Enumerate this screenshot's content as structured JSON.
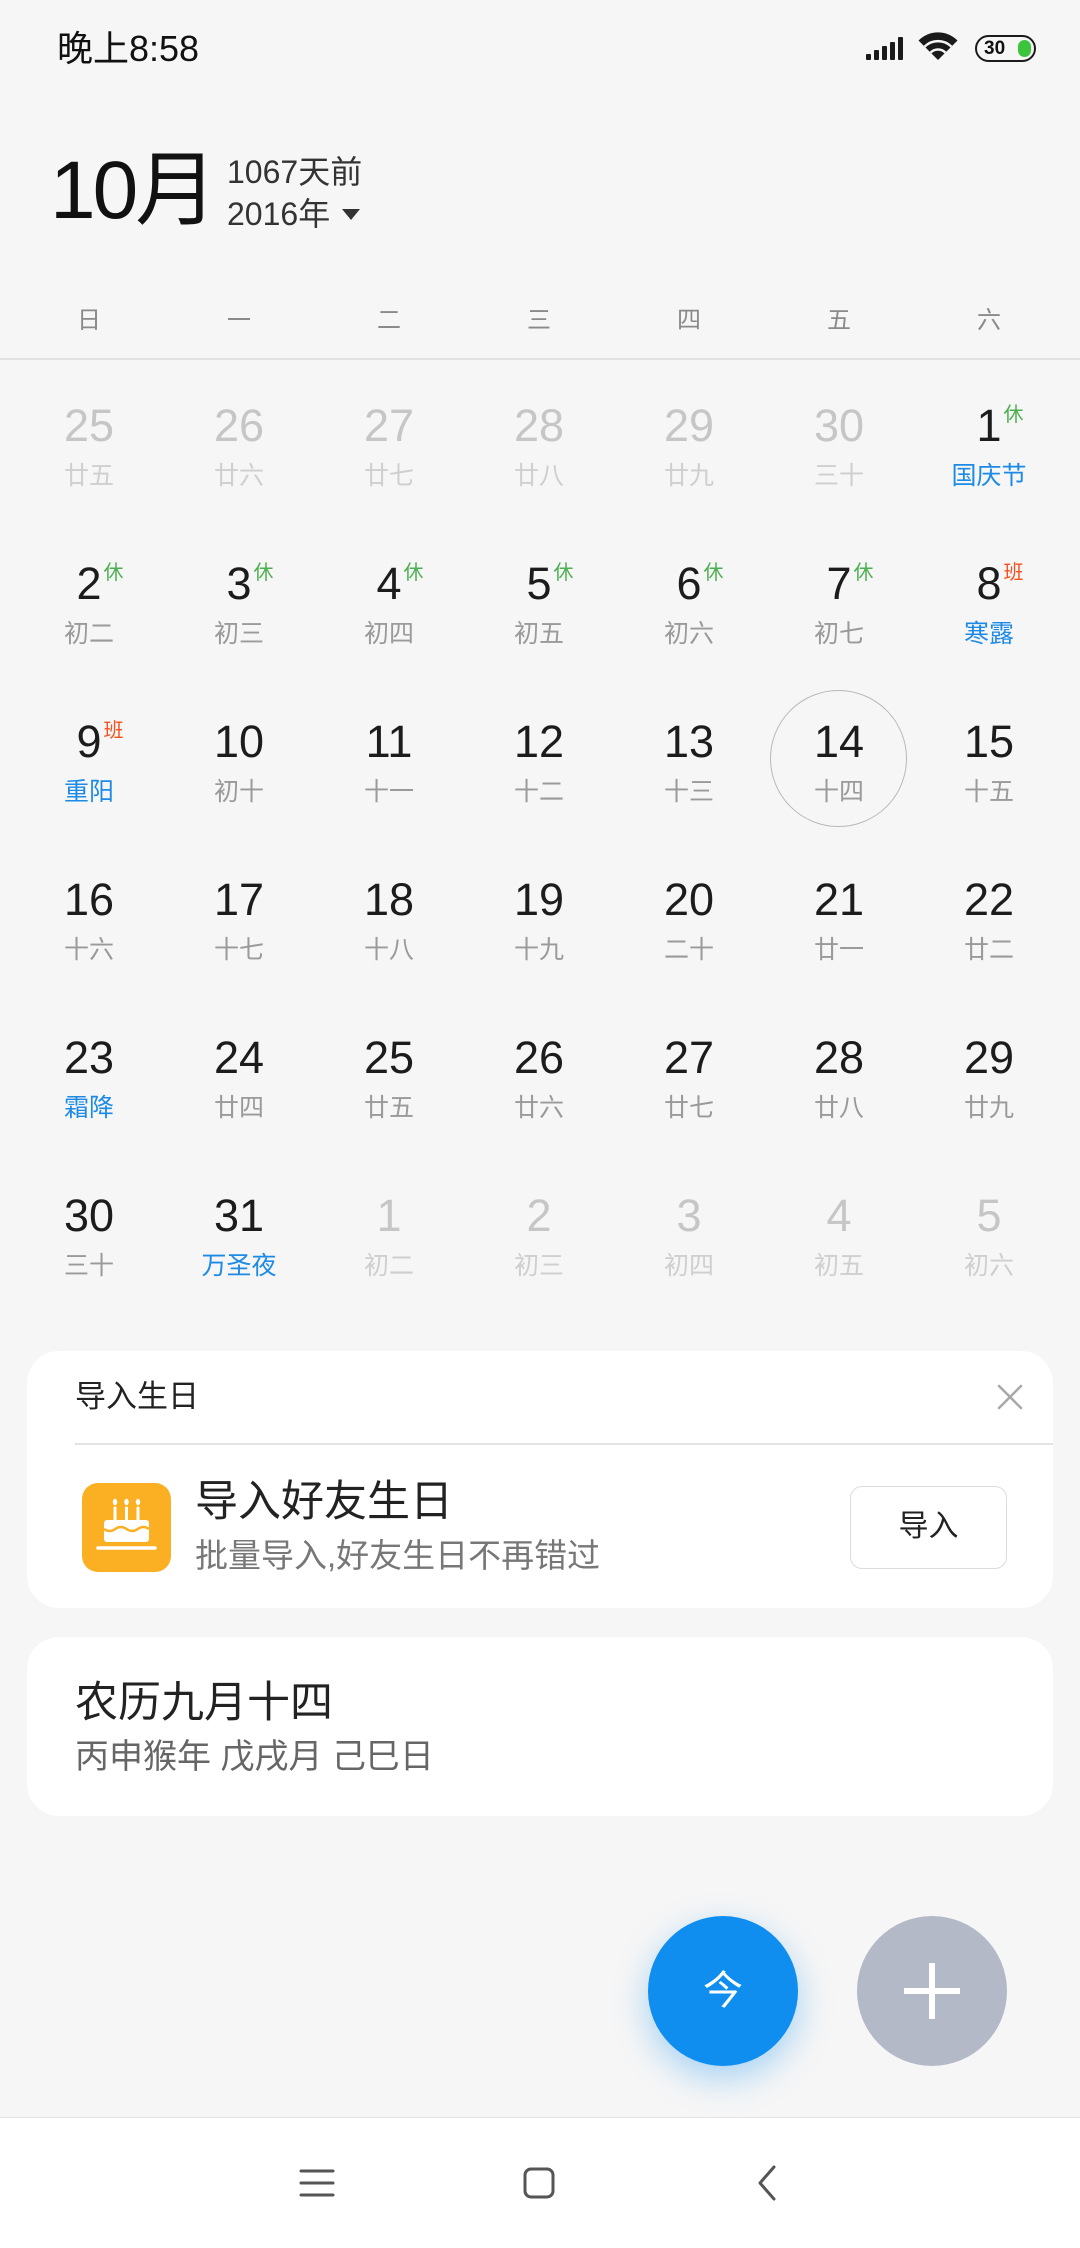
{
  "status_bar": {
    "time": "晚上8:58",
    "battery_level": "30",
    "icons": {
      "signal": "cellular-signal-icon",
      "wifi": "wifi-icon",
      "battery": "battery-icon"
    }
  },
  "header": {
    "month": "10月",
    "relative_days": "1067天前",
    "year": "2016年",
    "year_dropdown_icon": "caret-down-icon"
  },
  "weekdays": [
    "日",
    "一",
    "二",
    "三",
    "四",
    "五",
    "六"
  ],
  "calendar": {
    "weeks": [
      [
        {
          "day": "25",
          "lunar": "廿五",
          "other_month": true
        },
        {
          "day": "26",
          "lunar": "廿六",
          "other_month": true
        },
        {
          "day": "27",
          "lunar": "廿七",
          "other_month": true
        },
        {
          "day": "28",
          "lunar": "廿八",
          "other_month": true
        },
        {
          "day": "29",
          "lunar": "廿九",
          "other_month": true
        },
        {
          "day": "30",
          "lunar": "三十",
          "other_month": true
        },
        {
          "day": "1",
          "lunar": "国庆节",
          "badge": "休",
          "festival": true
        }
      ],
      [
        {
          "day": "2",
          "lunar": "初二",
          "badge": "休"
        },
        {
          "day": "3",
          "lunar": "初三",
          "badge": "休"
        },
        {
          "day": "4",
          "lunar": "初四",
          "badge": "休"
        },
        {
          "day": "5",
          "lunar": "初五",
          "badge": "休"
        },
        {
          "day": "6",
          "lunar": "初六",
          "badge": "休"
        },
        {
          "day": "7",
          "lunar": "初七",
          "badge": "休"
        },
        {
          "day": "8",
          "lunar": "寒露",
          "badge": "班",
          "festival": true
        }
      ],
      [
        {
          "day": "9",
          "lunar": "重阳",
          "badge": "班",
          "festival": true
        },
        {
          "day": "10",
          "lunar": "初十"
        },
        {
          "day": "11",
          "lunar": "十一"
        },
        {
          "day": "12",
          "lunar": "十二"
        },
        {
          "day": "13",
          "lunar": "十三"
        },
        {
          "day": "14",
          "lunar": "十四",
          "selected": true
        },
        {
          "day": "15",
          "lunar": "十五"
        }
      ],
      [
        {
          "day": "16",
          "lunar": "十六"
        },
        {
          "day": "17",
          "lunar": "十七"
        },
        {
          "day": "18",
          "lunar": "十八"
        },
        {
          "day": "19",
          "lunar": "十九"
        },
        {
          "day": "20",
          "lunar": "二十"
        },
        {
          "day": "21",
          "lunar": "廿一"
        },
        {
          "day": "22",
          "lunar": "廿二"
        }
      ],
      [
        {
          "day": "23",
          "lunar": "霜降",
          "festival": true
        },
        {
          "day": "24",
          "lunar": "廿四"
        },
        {
          "day": "25",
          "lunar": "廿五"
        },
        {
          "day": "26",
          "lunar": "廿六"
        },
        {
          "day": "27",
          "lunar": "廿七"
        },
        {
          "day": "28",
          "lunar": "廿八"
        },
        {
          "day": "29",
          "lunar": "廿九"
        }
      ],
      [
        {
          "day": "30",
          "lunar": "三十"
        },
        {
          "day": "31",
          "lunar": "万圣夜",
          "festival": true
        },
        {
          "day": "1",
          "lunar": "初二",
          "other_month": true
        },
        {
          "day": "2",
          "lunar": "初三",
          "other_month": true
        },
        {
          "day": "3",
          "lunar": "初四",
          "other_month": true
        },
        {
          "day": "4",
          "lunar": "初五",
          "other_month": true
        },
        {
          "day": "5",
          "lunar": "初六",
          "other_month": true
        }
      ]
    ]
  },
  "birthday_card": {
    "title": "导入生日",
    "close_icon": "close-icon",
    "item_icon": "birthday-cake-icon",
    "item_title": "导入好友生日",
    "item_subtitle": "批量导入,好友生日不再错过",
    "import_button": "导入"
  },
  "lunar_card": {
    "title": "农历九月十四",
    "subtitle": "丙申猴年 戊戌月 己巳日"
  },
  "fab": {
    "today_label": "今",
    "add_icon": "plus-icon"
  },
  "nav_bar": {
    "icons": {
      "menu": "menu-icon",
      "home": "home-square-icon",
      "back": "back-chevron-icon"
    }
  },
  "colors": {
    "page_background": "#f6f6f6",
    "festival_label": "#1d8ae6",
    "today_fab": "#0f8ef0",
    "add_fab": "#b3b9c7",
    "birthday_icon": "#fbb024",
    "battery_charge": "#3dc43d",
    "badge": {
      "休": "#4caf50",
      "班": "#f4511e"
    }
  }
}
